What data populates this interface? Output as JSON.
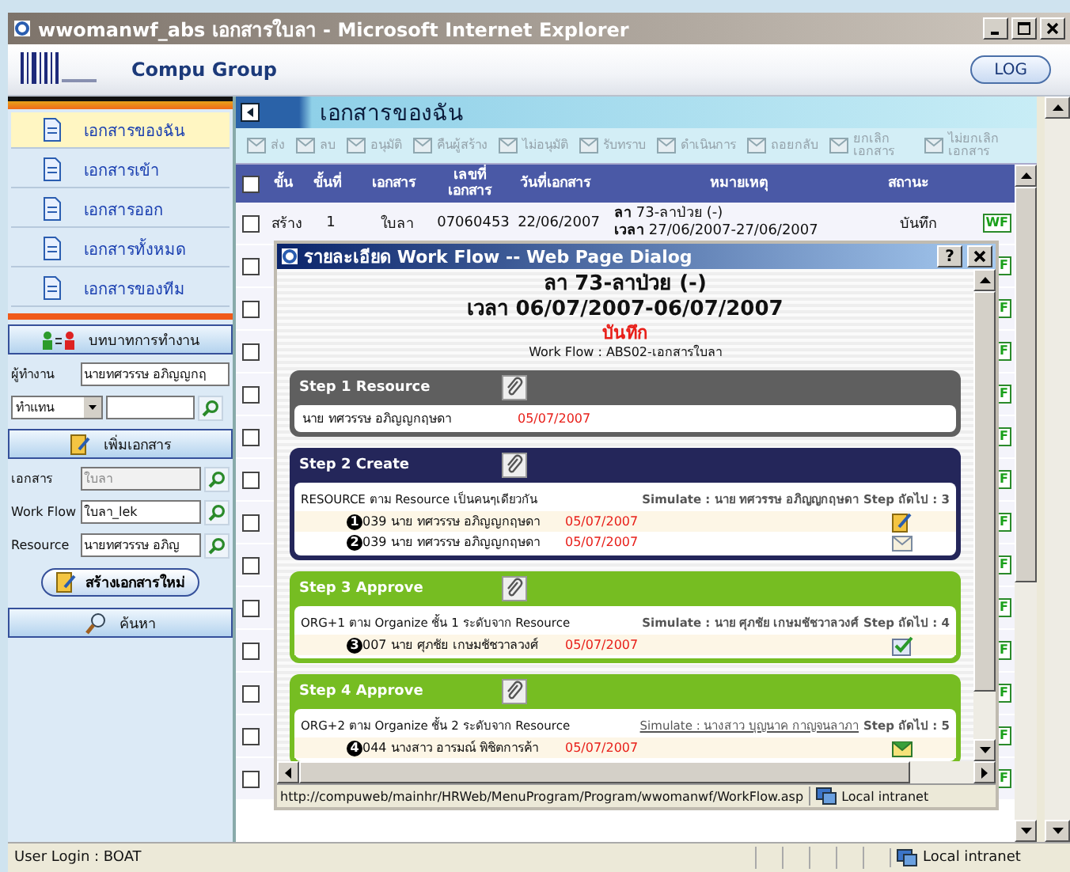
{
  "window": {
    "title": "wwomanwf_abs เอกสารใบลา - Microsoft Internet Explorer"
  },
  "header": {
    "company": "Compu Group",
    "logout_button": "LOG"
  },
  "sidebar": {
    "nav": [
      {
        "label": "เอกสารของฉัน",
        "selected": true
      },
      {
        "label": "เอกสารเข้า",
        "selected": false
      },
      {
        "label": "เอกสารออก",
        "selected": false
      },
      {
        "label": "เอกสารทั้งหมด",
        "selected": false
      },
      {
        "label": "เอกสารของทีม",
        "selected": false
      }
    ],
    "role_panel": {
      "title": "บทบาทการทำงาน",
      "worker_label": "ผู้ทำงาน",
      "worker_value": "นายทศวรรษ อภิญญกฤ",
      "mode_select": "ทำแทน"
    },
    "add_panel": {
      "title": "เพิ่มเอกสาร",
      "fields": [
        {
          "label": "เอกสาร",
          "value": "ใบลา",
          "disabled": true
        },
        {
          "label": "Work Flow",
          "value": "ใบลา_lek",
          "disabled": false
        },
        {
          "label": "Resource",
          "value": "นายทศวรรษ อภิญ",
          "disabled": false
        }
      ],
      "create_button": "สร้างเอกสารใหม่"
    },
    "search_panel": {
      "title": "ค้นหา"
    }
  },
  "main": {
    "title": "เอกสารของฉัน",
    "toolbar": [
      {
        "label": "ส่ง",
        "disabled": true
      },
      {
        "label": "ลบ",
        "disabled": true
      },
      {
        "label": "อนุมัติ",
        "disabled": true
      },
      {
        "label": "คืนผู้สร้าง",
        "disabled": true
      },
      {
        "label": "ไม่อนุมัติ",
        "disabled": true
      },
      {
        "label": "รับทราบ",
        "disabled": true
      },
      {
        "label": "ดำเนินการ",
        "disabled": true
      },
      {
        "label": "ถอยกลับ",
        "disabled": true
      },
      {
        "label": "ยกเลิก เอกสาร",
        "disabled": true
      },
      {
        "label": "ไม่ยกเลิก เอกสาร",
        "disabled": true
      }
    ],
    "table": {
      "select_all": false,
      "columns": [
        "ขั้น",
        "ขั้นที่",
        "เอกสาร",
        "เลขที่ เอกสาร",
        "วันที่เอกสาร",
        "หมายเหตุ",
        "สถานะ"
      ],
      "rows": [
        {
          "checked": false,
          "cells": [
            "สร้าง",
            "1",
            "ใบลา",
            "07060453",
            "22/06/2007"
          ],
          "note": [
            "**ลา** 73-ลาป่วย (-)",
            "**เวลา** 27/06/2007-27/06/2007"
          ],
          "status": "บันทึก",
          "badge": "WF"
        },
        {
          "checked": false,
          "badge": "F"
        },
        {
          "checked": false,
          "badge": "F"
        },
        {
          "checked": false,
          "badge": "F"
        },
        {
          "checked": false,
          "badge": "F"
        },
        {
          "checked": false,
          "badge": "F"
        },
        {
          "checked": false,
          "badge": "F"
        },
        {
          "checked": false,
          "badge": "F"
        },
        {
          "checked": false,
          "badge": "F"
        },
        {
          "checked": false,
          "badge": "F"
        },
        {
          "checked": false,
          "badge": "F"
        },
        {
          "checked": false,
          "badge": "F"
        },
        {
          "checked": false,
          "badge": "F"
        },
        {
          "checked": false,
          "badge": "F"
        }
      ]
    }
  },
  "dialog": {
    "title": "รายละเอียด Work Flow -- Web Page Dialog",
    "help_button": "?",
    "heading": "ลา 73-ลาป่วย (-)",
    "period": "เวลา 06/07/2007-06/07/2007",
    "status": "บันทึก",
    "workflow": "Work Flow : ABS02-เอกสารใบลา",
    "steps": [
      {
        "title": "Step 1 Resource",
        "color": "#5f5f5f",
        "entries": [
          {
            "text": "นาย ทศวรรษ อภิญญกฤษดา",
            "date": "05/07/2007",
            "highlighted": false
          }
        ]
      },
      {
        "title": "Step 2 Create",
        "color": "#24265a",
        "rule": "RESOURCE ตาม Resource เป็นคนๆเดียวกัน",
        "simulate": "Simulate : นาย ทศวรรษ อภิญญกฤษดา",
        "simulate_underlined": false,
        "next_step": "Step ถัดไป : 3",
        "entries": [
          {
            "number": "1",
            "text": "039 นาย ทศวรรษ อภิญญกฤษดา",
            "date": "05/07/2007",
            "kind": "edit",
            "highlighted": true
          },
          {
            "number": "2",
            "text": "039 นาย ทศวรรษ อภิญญกฤษดา",
            "date": "05/07/2007",
            "kind": "mail",
            "highlighted": false
          }
        ]
      },
      {
        "title": "Step 3 Approve",
        "color": "#76bd22",
        "rule": "ORG+1 ตาม Organize ชั้น 1 ระดับจาก Resource",
        "simulate": "Simulate : นาย ศุภชัย เกษมชัชวาลวงศ์",
        "simulate_underlined": false,
        "next_step": "Step ถัดไป : 4",
        "entries": [
          {
            "number": "3",
            "text": "007 นาย ศุภชัย เกษมชัชวาลวงศ์",
            "date": "05/07/2007",
            "kind": "approve",
            "highlighted": true
          }
        ]
      },
      {
        "title": "Step 4 Approve",
        "color": "#76bd22",
        "rule": "ORG+2 ตาม Organize ชั้น 2 ระดับจาก Resource",
        "simulate": "Simulate : นางสาว บุญนาค กาญจนลาภา",
        "simulate_underlined": true,
        "next_step": "Step ถัดไป : 5",
        "entries": [
          {
            "number": "4",
            "text": "044 นางสาว อารมณ์ พิชิตการค้า",
            "date": "05/07/2007",
            "kind": "received",
            "highlighted": true
          }
        ]
      }
    ],
    "url": "http://compuweb/mainhr/HRWeb/MenuProgram/Program/wwomanwf/WorkFlow.asp",
    "zone": "Local intranet"
  },
  "status_bar": {
    "text": "User Login : BOAT",
    "zone": "Local intranet"
  }
}
